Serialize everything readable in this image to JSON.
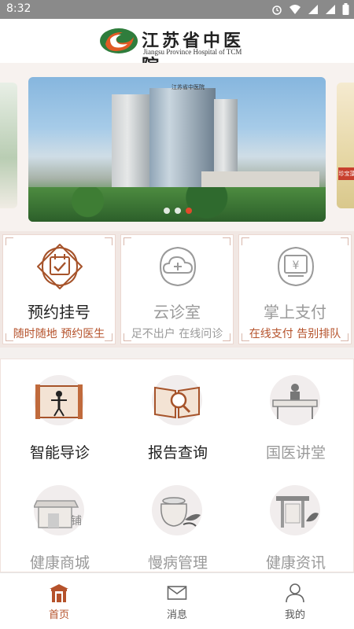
{
  "status_bar": {
    "time": "8:32"
  },
  "header": {
    "logo_zh": "江苏省中医院",
    "logo_en": "Jiangsu Province Hospital of TCM"
  },
  "banner": {
    "sign_text": "江苏省中医院",
    "dot_count": 3,
    "active_dot": 3,
    "side_tag": "珍宝藻"
  },
  "primary_services": [
    {
      "title": "预约挂号",
      "subtitle": "随时随地 预约医生",
      "enabled": true,
      "icon": "calendar-check-icon"
    },
    {
      "title": "云诊室",
      "subtitle": "足不出户 在线问诊",
      "enabled": false,
      "icon": "cloud-plus-icon"
    },
    {
      "title": "掌上支付",
      "subtitle": "在线支付 告别排队",
      "enabled": false,
      "icon": "yen-payment-icon"
    }
  ],
  "secondary_services": [
    {
      "label": "智能导诊",
      "enabled": true,
      "icon": "body-chart-scroll-icon"
    },
    {
      "label": "报告查询",
      "enabled": true,
      "icon": "book-magnifier-icon"
    },
    {
      "label": "国医讲堂",
      "enabled": false,
      "icon": "lecture-desk-icon"
    },
    {
      "label": "健康商城",
      "enabled": false,
      "icon": "shop-icon",
      "icon_text": "铺"
    },
    {
      "label": "慢病管理",
      "enabled": false,
      "icon": "herb-pot-icon"
    },
    {
      "label": "健康资讯",
      "enabled": false,
      "icon": "gate-plant-icon"
    }
  ],
  "tabbar": [
    {
      "label": "首页",
      "icon": "home-gate-icon",
      "active": true
    },
    {
      "label": "消息",
      "icon": "mail-icon",
      "active": false
    },
    {
      "label": "我的",
      "icon": "user-icon",
      "active": false
    }
  ],
  "colors": {
    "accent": "#b5522b",
    "icon_brown": "#a6532a",
    "disabled_text": "#9a9a9a",
    "sub_text_red": "#b5522b",
    "dot_active": "#e2492b"
  }
}
